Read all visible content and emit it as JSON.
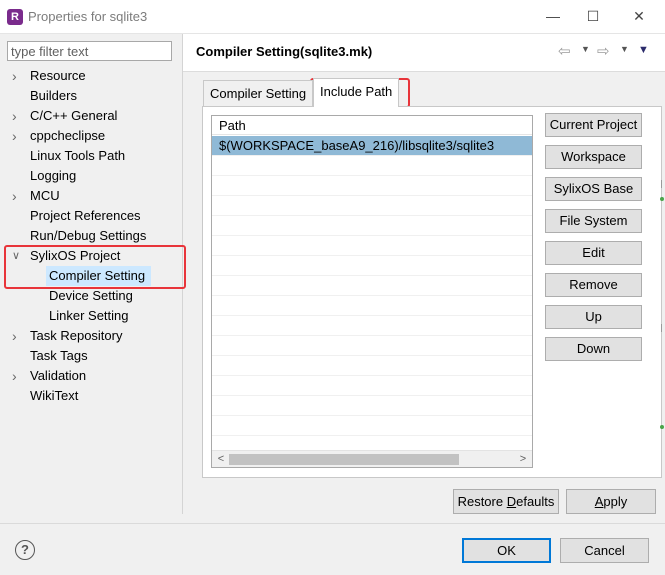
{
  "window": {
    "title": "Properties for sqlite3",
    "app_icon_letter": "R"
  },
  "filter": {
    "placeholder": "type filter text",
    "value": ""
  },
  "tree": [
    {
      "label": "Resource",
      "expandable": true,
      "expanded": false,
      "indent": 0
    },
    {
      "label": "Builders",
      "expandable": false,
      "indent": 0
    },
    {
      "label": "C/C++ General",
      "expandable": true,
      "expanded": false,
      "indent": 0
    },
    {
      "label": "cppcheclipse",
      "expandable": true,
      "expanded": false,
      "indent": 0
    },
    {
      "label": "Linux Tools Path",
      "expandable": false,
      "indent": 0
    },
    {
      "label": "Logging",
      "expandable": false,
      "indent": 0
    },
    {
      "label": "MCU",
      "expandable": true,
      "expanded": false,
      "indent": 0
    },
    {
      "label": "Project References",
      "expandable": false,
      "indent": 0
    },
    {
      "label": "Run/Debug Settings",
      "expandable": false,
      "indent": 0
    },
    {
      "label": "SylixOS Project",
      "expandable": true,
      "expanded": true,
      "indent": 0
    },
    {
      "label": "Compiler Setting",
      "expandable": false,
      "indent": 1,
      "selected": true
    },
    {
      "label": "Device Setting",
      "expandable": false,
      "indent": 1
    },
    {
      "label": "Linker Setting",
      "expandable": false,
      "indent": 1
    },
    {
      "label": "Task Repository",
      "expandable": true,
      "expanded": false,
      "indent": 0
    },
    {
      "label": "Task Tags",
      "expandable": false,
      "indent": 0
    },
    {
      "label": "Validation",
      "expandable": true,
      "expanded": false,
      "indent": 0
    },
    {
      "label": "WikiText",
      "expandable": false,
      "indent": 0
    }
  ],
  "page": {
    "title": "Compiler Setting(sqlite3.mk)"
  },
  "tabs": [
    {
      "label": "Compiler Setting",
      "active": false
    },
    {
      "label": "Include Path",
      "active": true
    }
  ],
  "path_table": {
    "header": "Path",
    "rows": [
      {
        "value": "$(WORKSPACE_baseA9_216)/libsqlite3/sqlite3",
        "selected": true
      }
    ]
  },
  "side_buttons": [
    "Current Project",
    "Workspace",
    "SylixOS Base",
    "File System",
    "Edit",
    "Remove",
    "Up",
    "Down"
  ],
  "restore_defaults": {
    "label": "Restore Defaults",
    "mnemonic": "D"
  },
  "apply": {
    "label": "Apply",
    "mnemonic": "A"
  },
  "dialog_buttons": {
    "ok": "OK",
    "cancel": "Cancel"
  },
  "colors": {
    "highlight_border": "#e8343a",
    "selected_row": "#8fb9d6",
    "tree_selection": "#cce8ff"
  }
}
